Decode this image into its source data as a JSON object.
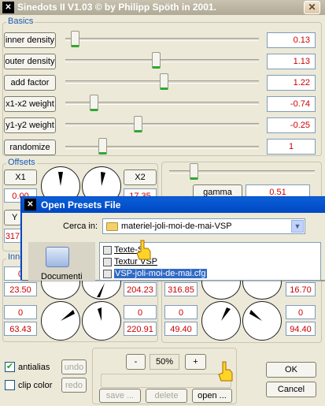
{
  "title": "Sinedots II V1.03 © by Philipp Spöth in 2001.",
  "close_glyph": "✕",
  "basics": {
    "label": "Basics",
    "rows": [
      {
        "name": "inner density",
        "value": "0.13",
        "level": 0.03
      },
      {
        "name": "outer density",
        "value": "1.13",
        "level": 0.47
      },
      {
        "name": "add factor",
        "value": "1.22",
        "level": 0.51
      },
      {
        "name": "x1-x2 weight",
        "value": "-0.74",
        "level": 0.13
      },
      {
        "name": "y1-y2 weight",
        "value": "-0.25",
        "level": 0.37
      }
    ],
    "randomize_label": "randomize",
    "randomize_value": "1",
    "randomize_level": 0.18
  },
  "offsets": {
    "label": "Offsets",
    "x1_label": "X1",
    "x2_label": "X2",
    "x1_value": "0.00",
    "x2_value": "17.35",
    "y_label_partial": "Y",
    "y_value_partial": "317"
  },
  "gamma": {
    "label": "gamma",
    "value": "0.51",
    "level": 0.15
  },
  "inner_label_partial": "Inne",
  "inner_values": {
    "left_top": "0",
    "left_mid": "23.50",
    "left_center": "204.23",
    "right_mid1": "316.85",
    "right_mid2": "16.70",
    "left_low": "0",
    "left_bottom": "63.43",
    "center_low": "0",
    "center_bottom": "220.91",
    "right_low1": "0",
    "right_bottom1": "49.40",
    "right_low2": "0",
    "right_bottom2": "94.40"
  },
  "options": {
    "antialias_label": "antialias",
    "antialias_checked": true,
    "clipcolor_label": "clip color",
    "clipcolor_checked": false
  },
  "undo_label": "undo",
  "redo_label": "redo",
  "zoom": {
    "minus": "-",
    "value": "50%",
    "plus": "+"
  },
  "file_buttons": {
    "save": "save ...",
    "delete": "delete",
    "open": "open ..."
  },
  "ok_label": "OK",
  "cancel_label": "Cancel",
  "dialog": {
    "title": "Open Presets File",
    "look_in_label": "Cerca in:",
    "look_in_value": "materiel-joli-moi-de-mai-VSP",
    "places_label": "Documenti",
    "files": [
      {
        "name": "Texte-S",
        "selected": false
      },
      {
        "name": "Textur VSP",
        "selected": false
      },
      {
        "name": "VSP-joli-moi-de-mai.cfg",
        "selected": true
      }
    ]
  },
  "colors": {
    "value_text": "#cc0000",
    "group_label": "#1c5bb8",
    "dialog_title": "#0047c4",
    "selection": "#316ac5"
  }
}
